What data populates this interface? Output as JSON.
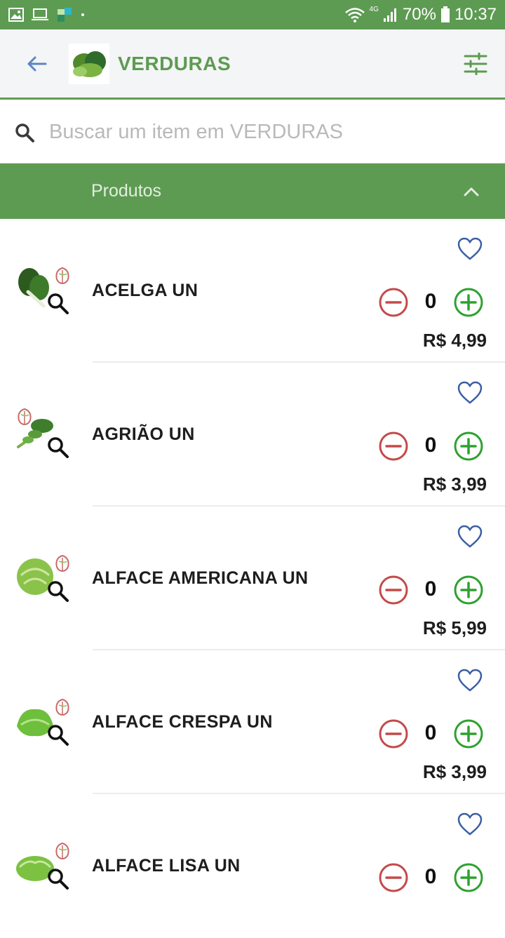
{
  "status_bar": {
    "network": "4G",
    "battery": "70%",
    "time": "10:37",
    "icons": [
      "gallery-icon",
      "laptop-icon",
      "app-icon",
      "dot-icon",
      "wifi-icon",
      "signal-icon",
      "battery-icon"
    ]
  },
  "header": {
    "title": "VERDURAS",
    "back_icon": "arrow-left-icon",
    "filter_icon": "sliders-icon"
  },
  "search": {
    "placeholder": "Buscar um item em VERDURAS",
    "value": ""
  },
  "section": {
    "label": "Produtos",
    "chevron": "chevron-up-icon"
  },
  "products": [
    {
      "name": "ACELGA UN",
      "qty": "0",
      "price": "R$ 4,99"
    },
    {
      "name": "AGRIÃO UN",
      "qty": "0",
      "price": "R$ 3,99"
    },
    {
      "name": "ALFACE AMERICANA UN",
      "qty": "0",
      "price": "R$ 5,99"
    },
    {
      "name": "ALFACE CRESPA UN",
      "qty": "0",
      "price": "R$ 3,99"
    },
    {
      "name": "ALFACE LISA UN",
      "qty": "0",
      "price": ""
    }
  ],
  "colors": {
    "brand_green": "#5d9b52",
    "minus_red": "#c44a4a",
    "plus_green": "#2ea12e",
    "heart_blue": "#3a5fa3",
    "back_blue": "#5b86c2"
  }
}
